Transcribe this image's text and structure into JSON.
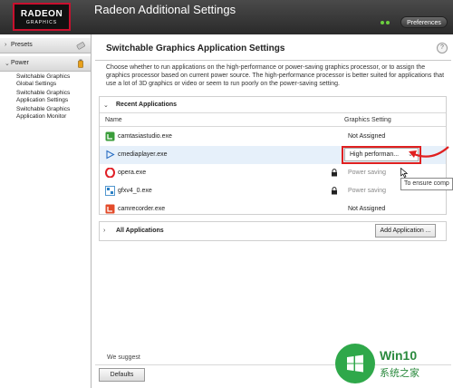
{
  "header": {
    "logo_line1": "RADEON",
    "logo_line2": "GRAPHICS",
    "title": "Radeon Additional Settings",
    "preferences_label": "Preferences"
  },
  "sidebar": {
    "presets_label": "Presets",
    "power_label": "Power",
    "items": [
      {
        "label_line1": "Switchable Graphics",
        "label_line2": "Global Settings"
      },
      {
        "label_line1": "Switchable Graphics",
        "label_line2": "Application Settings"
      },
      {
        "label_line1": "Switchable Graphics",
        "label_line2": "Application Monitor"
      }
    ]
  },
  "main": {
    "title": "Switchable Graphics Application Settings",
    "help_label": "?",
    "description": "Choose whether to run applications on the high-performance or power-saving graphics processor, or to assign the graphics processor based on current power source. The high-performance processor is better suited for applications that use a lot of 3D graphics or video or seem to run poorly on the power-saving setting.",
    "recent": {
      "title": "Recent Applications",
      "col_name": "Name",
      "col_setting": "Graphics Setting",
      "rows": [
        {
          "name": "camtasiastudio.exe",
          "setting": "Not Assigned",
          "icon": "camtasia-icon"
        },
        {
          "name": "cmediaplayer.exe",
          "setting": "High performan...",
          "icon": "play-icon"
        },
        {
          "name": "opera.exe",
          "setting": "Power saving",
          "icon": "opera-icon"
        },
        {
          "name": "gfxv4_0.exe",
          "setting": "Power saving",
          "icon": "gfx-icon"
        },
        {
          "name": "camrecorder.exe",
          "setting": "Not Assigned",
          "icon": "camrecorder-icon"
        }
      ]
    },
    "all_apps": {
      "title": "All Applications",
      "add_button": "Add Application ..."
    },
    "tooltip": "To ensure comp",
    "footer_text": "We suggest",
    "defaults_button": "Defaults"
  },
  "watermark": {
    "line1": "Win10",
    "line2": "系统之家"
  },
  "colors": {
    "header": "#2a2a2a",
    "accent_red": "#e02020",
    "selected_row": "#e6f0fa",
    "watermark_green": "#2fa84a"
  }
}
